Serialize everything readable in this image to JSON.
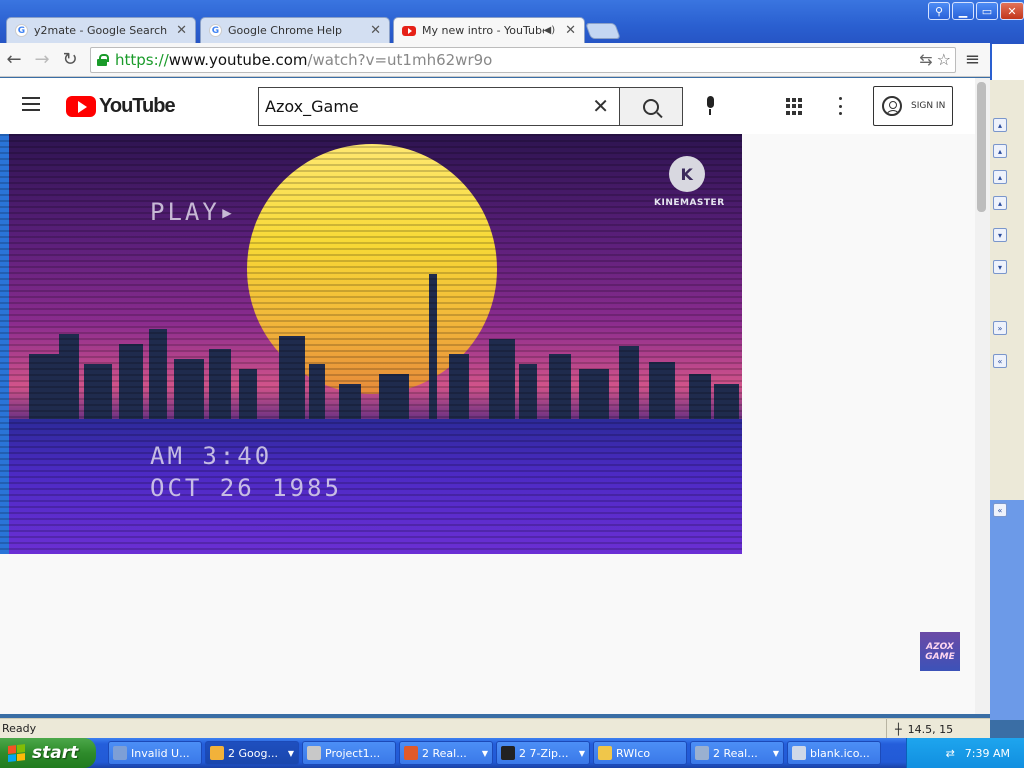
{
  "browser": {
    "tabs": [
      {
        "title": "y2mate - Google Search",
        "favicon": "google-icon",
        "active": false
      },
      {
        "title": "Google Chrome Help",
        "favicon": "google-icon",
        "active": false
      },
      {
        "title": "My new intro - YouTube",
        "favicon": "youtube-icon",
        "active": true
      }
    ],
    "url": {
      "scheme": "https://",
      "host": "www.youtube.com",
      "path": "/watch?v=ut1mh62wr9o"
    }
  },
  "youtube": {
    "logo_text": "YouTube",
    "search": {
      "value": "Azox_Game",
      "clear_label": "✕"
    },
    "sign_in_label": "SIGN IN",
    "video": {
      "osd_play": "PLAY▸",
      "osd_time": "AM 3:40",
      "osd_date": "OCT 26 1985",
      "watermark_letter": "K",
      "watermark_label": "KINEMASTER"
    },
    "channel_badge": {
      "line1": "AZOX",
      "line2": "GAME"
    }
  },
  "status_bar": {
    "text": "Ready",
    "coords": "14.5, 15"
  },
  "taskbar": {
    "start_label": "start",
    "tasks": [
      {
        "label": "Invalid U...",
        "icon_color": "#7d9fd6",
        "has_arrow": false
      },
      {
        "label": "2 Goog...",
        "icon_color": "#f2b23a",
        "has_arrow": true,
        "active": true
      },
      {
        "label": "Project1...",
        "icon_color": "#c8c8c8",
        "has_arrow": false
      },
      {
        "label": "2 Real...",
        "icon_color": "#e05a2a",
        "has_arrow": true
      },
      {
        "label": "2 7-Zip...",
        "icon_color": "#222222",
        "has_arrow": true
      },
      {
        "label": "RWIco",
        "icon_color": "#f0c64a",
        "has_arrow": false
      },
      {
        "label": "2 Real...",
        "icon_color": "#9ab0d0",
        "has_arrow": true
      },
      {
        "label": "blank.ico...",
        "icon_color": "#cfd8e8",
        "has_arrow": false
      }
    ],
    "clock": "7:39 AM"
  },
  "colors": {
    "accent_youtube": "#ff0000",
    "secure_green": "#1a9b2a",
    "xp_taskbar": "#245edb",
    "xp_start": "#2e8b2b"
  }
}
